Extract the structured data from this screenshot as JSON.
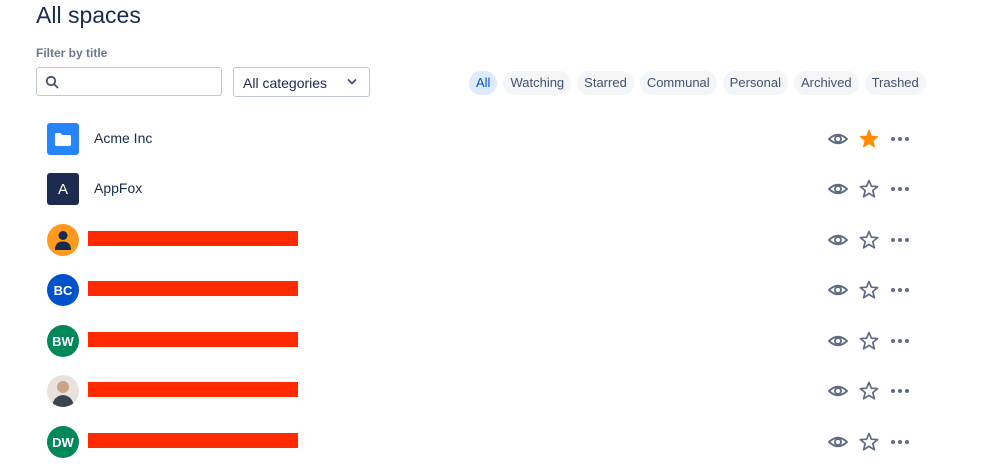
{
  "header": {
    "title": "All spaces"
  },
  "filter": {
    "label": "Filter by title",
    "search_value": "",
    "search_placeholder": "",
    "category_selected": "All categories"
  },
  "tabs": [
    {
      "label": "All",
      "active": true
    },
    {
      "label": "Watching",
      "active": false
    },
    {
      "label": "Starred",
      "active": false
    },
    {
      "label": "Communal",
      "active": false
    },
    {
      "label": "Personal",
      "active": false
    },
    {
      "label": "Archived",
      "active": false
    },
    {
      "label": "Trashed",
      "active": false
    }
  ],
  "spaces": [
    {
      "name": "Acme Inc",
      "avatar_type": "folder-icon",
      "avatar_color": "#2684ff",
      "starred": true,
      "redacted": false
    },
    {
      "name": "AppFox",
      "avatar_type": "letter",
      "avatar_text": "A",
      "avatar_color": "#1d2b4f",
      "starred": false,
      "redacted": false
    },
    {
      "name": "",
      "avatar_type": "person-icon",
      "avatar_color": "#ff991f",
      "starred": false,
      "redacted": true
    },
    {
      "name": "",
      "avatar_type": "initials",
      "avatar_text": "BC",
      "avatar_color": "#0052cc",
      "starred": false,
      "redacted": true
    },
    {
      "name": "",
      "avatar_type": "initials",
      "avatar_text": "BW",
      "avatar_color": "#00875a",
      "starred": false,
      "redacted": true
    },
    {
      "name": "",
      "avatar_type": "photo",
      "avatar_color": "#c9a48a",
      "starred": false,
      "redacted": true
    },
    {
      "name": "",
      "avatar_type": "initials",
      "avatar_text": "DW",
      "avatar_color": "#00875a",
      "starred": false,
      "redacted": true
    }
  ],
  "colors": {
    "star_active": "#ff8b00",
    "icon_gray": "#5e6c84",
    "redaction": "#ff2a00"
  }
}
